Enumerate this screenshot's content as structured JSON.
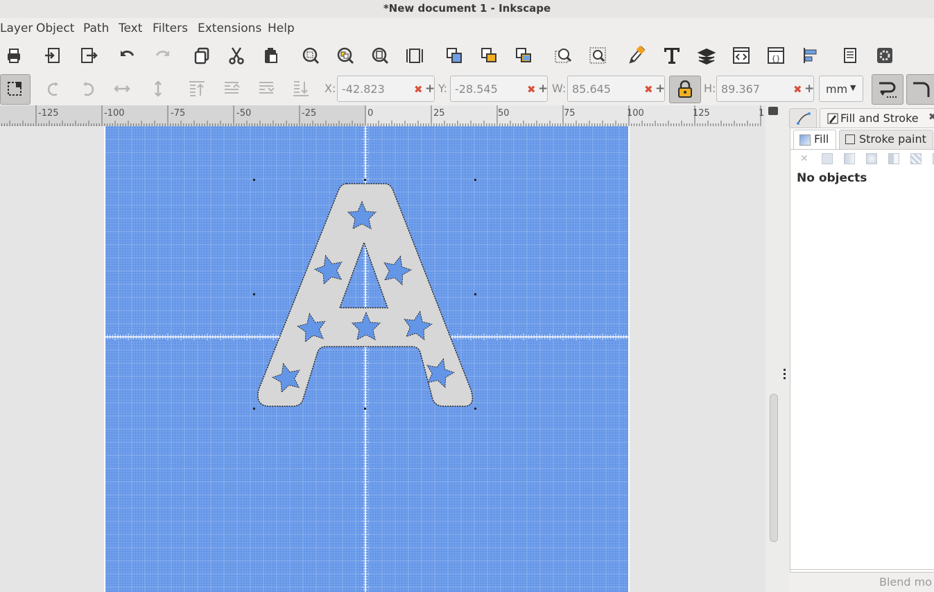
{
  "window": {
    "title": "*New document 1 - Inkscape"
  },
  "menu": [
    "Layer",
    "Object",
    "Path",
    "Text",
    "Filters",
    "Extensions",
    "Help"
  ],
  "toolbar": {
    "icons": [
      "print-icon",
      "import-icon",
      "export-icon",
      "undo-icon",
      "redo-icon",
      "duplicate-icon",
      "cut-icon",
      "paste-icon",
      "zoom-selection-icon",
      "zoom-drawing-icon",
      "zoom-page-icon",
      "zoom-page-width-icon",
      "group-icon",
      "lock-group-icon",
      "ungroup-icon",
      "symbols-icon",
      "xml-editor-icon",
      "fill-stroke-icon",
      "text-font-icon",
      "layers-icon",
      "xml-icon",
      "css-icon",
      "align-icon",
      "document-properties-icon",
      "preferences-icon"
    ]
  },
  "transform": {
    "x_label": "X:",
    "x_value": "-42.823",
    "y_label": "Y:",
    "y_value": "-28.545",
    "w_label": "W:",
    "w_value": "85.645",
    "h_label": "H:",
    "h_value": "89.367",
    "unit": "mm"
  },
  "ruler": {
    "labels": [
      "-125",
      "-100",
      "-75",
      "-50",
      "-25",
      "0",
      "25",
      "50",
      "75",
      "100",
      "125",
      "1"
    ]
  },
  "dock": {
    "tab_fill_stroke": "Fill and Stroke",
    "fill_tab": "Fill",
    "stroke_paint_tab": "Stroke paint",
    "status": "No objects",
    "blend_mode": "Blend mo"
  },
  "colors": {
    "canvas_page": "#6496e8",
    "accent": "#4a90d9"
  }
}
